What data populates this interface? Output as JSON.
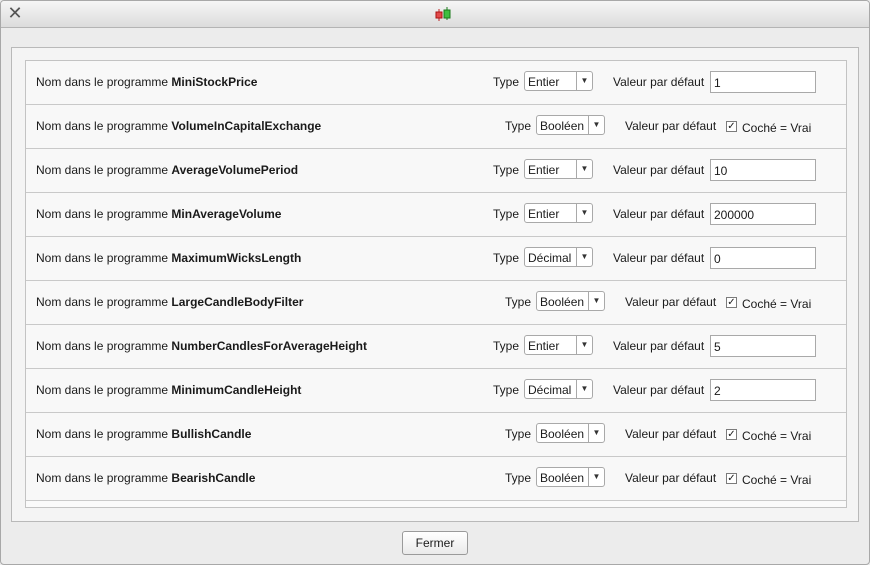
{
  "dialog": {
    "close_label": "Fermer"
  },
  "labels": {
    "name_prefix": "Nom dans le programme",
    "type": "Type",
    "default": "Valeur par défaut",
    "checked_true": "Coché = Vrai"
  },
  "rows": [
    {
      "name": "MiniStockPrice",
      "type": "Entier",
      "kind": "int",
      "value": "1"
    },
    {
      "name": "VolumeInCapitalExchange",
      "type": "Booléen",
      "kind": "bool",
      "checked": true
    },
    {
      "name": "AverageVolumePeriod",
      "type": "Entier",
      "kind": "int",
      "value": "10"
    },
    {
      "name": "MinAverageVolume",
      "type": "Entier",
      "kind": "int",
      "value": "200000"
    },
    {
      "name": "MaximumWicksLength",
      "type": "Décimal",
      "kind": "dec",
      "value": "0"
    },
    {
      "name": "LargeCandleBodyFilter",
      "type": "Booléen",
      "kind": "bool",
      "checked": true
    },
    {
      "name": "NumberCandlesForAverageHeight",
      "type": "Entier",
      "kind": "int",
      "value": "5"
    },
    {
      "name": "MinimumCandleHeight",
      "type": "Décimal",
      "kind": "dec",
      "value": "2"
    },
    {
      "name": "BullishCandle",
      "type": "Booléen",
      "kind": "bool",
      "checked": true
    },
    {
      "name": "BearishCandle",
      "type": "Booléen",
      "kind": "bool",
      "checked": true
    }
  ]
}
